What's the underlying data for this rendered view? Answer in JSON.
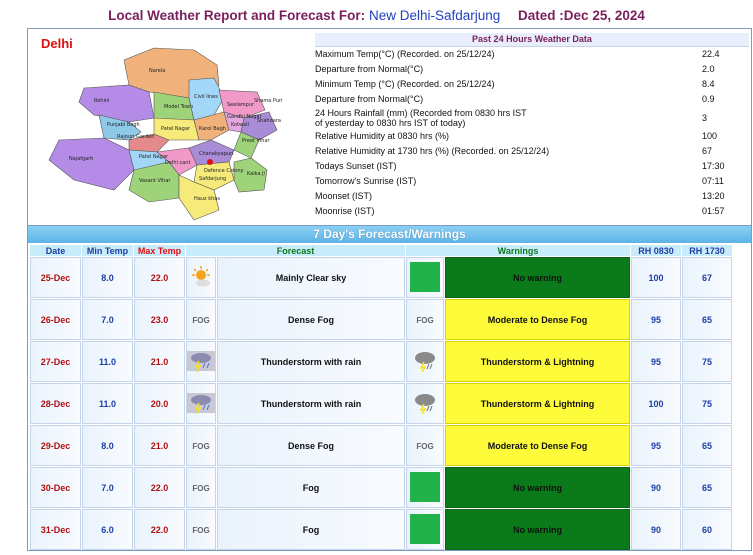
{
  "header": {
    "title_prefix": "Local Weather Report and Forecast For:",
    "location": "New Delhi-Safdarjung",
    "dated": "Dated :Dec 25, 2024"
  },
  "map": {
    "title": "Delhi",
    "districts": [
      "Narela",
      "Rohini",
      "Civil lines",
      "Model Town",
      "Seelampur",
      "Shahdara",
      "Punjabi Bagh",
      "Rajouri Garden",
      "Patel Nagar",
      "Karol Bagh",
      "Kotwali",
      "Preet Vihar",
      "Patel Nagar",
      "Najafgarh",
      "Delhi cant",
      "Chanakyapuri",
      "Vasant Vihar",
      "Defence Colony",
      "Safdarjung",
      "Kalka ji",
      "Hauz khas",
      "Gandhi Nagar",
      "Shama Puri"
    ],
    "district_colors": [
      "#f0b27a",
      "#b48be6",
      "#9fd37a",
      "#a98cd8",
      "#f19ac9",
      "#f5ea7a",
      "#8ec9e8",
      "#e58a8a",
      "#9fd37a",
      "#e6a7e0",
      "#a3d7f7"
    ]
  },
  "past24": {
    "heading": "Past 24 Hours Weather Data",
    "rows": [
      {
        "label": "Maximum Temp(°C) (Recorded. on 25/12/24)",
        "value": "22.4"
      },
      {
        "label": "Departure from Normal(°C)",
        "value": "2.0"
      },
      {
        "label": "Minimum Temp (°C) (Recorded. on 25/12/24)",
        "value": "8.4"
      },
      {
        "label": "Departure from Normal(°C)",
        "value": "0.9"
      },
      {
        "label": "24 Hours Rainfall (mm) (Recorded from 0830 hrs IST",
        "label2": "of yesterday to 0830 hrs IST of today)",
        "value": "3"
      },
      {
        "label": "Relative Humidity at 0830 hrs (%)",
        "value": "100"
      },
      {
        "label": "Relative Humidity at 1730 hrs (%) (Recorded. on 25/12/24)",
        "value": "67"
      },
      {
        "label": "Todays Sunset (IST)",
        "value": "17:30"
      },
      {
        "label": "Tomorrow's Sunrise (IST)",
        "value": "07:11"
      },
      {
        "label": "Moonset (IST)",
        "value": "13:20"
      },
      {
        "label": "Moonrise (IST)",
        "value": "01:57"
      }
    ]
  },
  "forecast": {
    "heading": "7 Day's Forecast/Warnings",
    "columns": {
      "date": "Date",
      "min": "Min Temp",
      "max": "Max Temp",
      "forecast": "Forecast",
      "warnings": "Warnings",
      "rh1": "RH 0830",
      "rh2": "RH 1730"
    },
    "fog_icon_text": "FOG",
    "rows": [
      {
        "date": "25-Dec",
        "min": "8.0",
        "max": "22.0",
        "icon": "sun-cloud-icon",
        "forecast": "Mainly Clear sky",
        "warn_icon": "green-square-icon",
        "warning": "No warning",
        "warn_color": "#0a7a1a",
        "rh1": "100",
        "rh2": "67"
      },
      {
        "date": "26-Dec",
        "min": "7.0",
        "max": "23.0",
        "icon": "fog-icon",
        "forecast": "Dense Fog",
        "warn_icon": "fog-icon",
        "warning": "Moderate to Dense Fog",
        "warn_color": "#fdfb3a",
        "rh1": "95",
        "rh2": "65"
      },
      {
        "date": "27-Dec",
        "min": "11.0",
        "max": "21.0",
        "icon": "thunderstorm-icon",
        "forecast": "Thunderstorm with rain",
        "warn_icon": "storm-cloud-icon",
        "warning": "Thunderstorm & Lightning",
        "warn_color": "#fdfb3a",
        "rh1": "95",
        "rh2": "75"
      },
      {
        "date": "28-Dec",
        "min": "11.0",
        "max": "20.0",
        "icon": "thunderstorm-icon",
        "forecast": "Thunderstorm with rain",
        "warn_icon": "storm-cloud-icon",
        "warning": "Thunderstorm & Lightning",
        "warn_color": "#fdfb3a",
        "rh1": "100",
        "rh2": "75"
      },
      {
        "date": "29-Dec",
        "min": "8.0",
        "max": "21.0",
        "icon": "fog-icon",
        "forecast": "Dense Fog",
        "warn_icon": "fog-icon",
        "warning": "Moderate to Dense Fog",
        "warn_color": "#fdfb3a",
        "rh1": "95",
        "rh2": "65"
      },
      {
        "date": "30-Dec",
        "min": "7.0",
        "max": "22.0",
        "icon": "fog-icon",
        "forecast": "Fog",
        "warn_icon": "green-square-icon",
        "warning": "No warning",
        "warn_color": "#0a7a1a",
        "rh1": "90",
        "rh2": "65"
      },
      {
        "date": "31-Dec",
        "min": "6.0",
        "max": "22.0",
        "icon": "fog-icon",
        "forecast": "Fog",
        "warn_icon": "green-square-icon",
        "warning": "No warning",
        "warn_color": "#0a7a1a",
        "rh1": "90",
        "rh2": "60"
      }
    ]
  }
}
